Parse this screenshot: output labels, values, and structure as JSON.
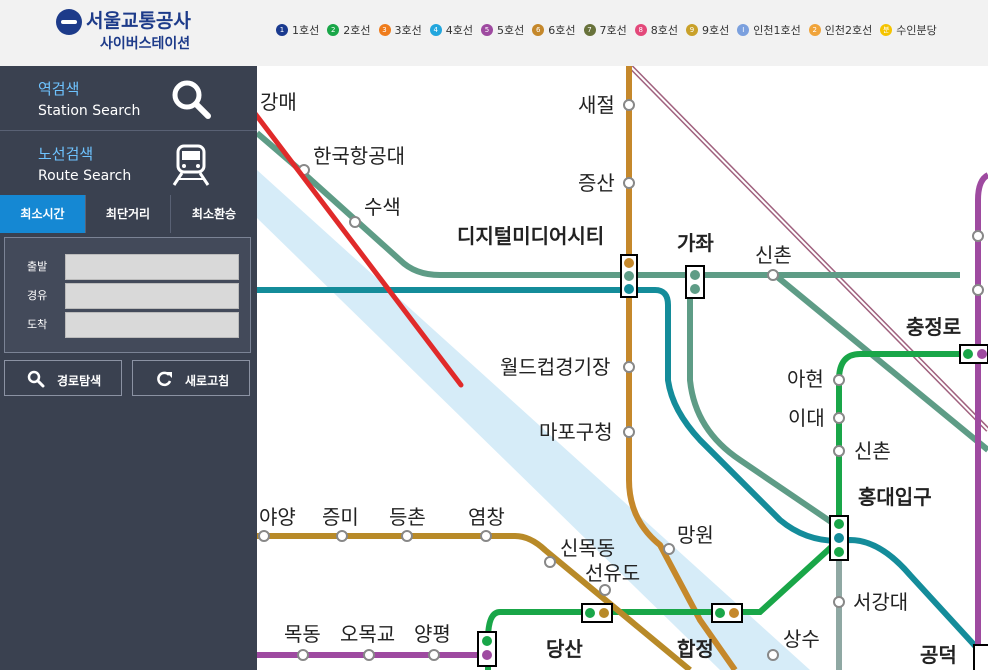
{
  "header": {
    "logo_title": "서울교통공사",
    "logo_subtitle": "사이버스테이션",
    "lines": [
      {
        "num": "1",
        "label": "1호선",
        "color": "#1a3a8f"
      },
      {
        "num": "2",
        "label": "2호선",
        "color": "#19a648"
      },
      {
        "num": "3",
        "label": "3호선",
        "color": "#ef7c1c"
      },
      {
        "num": "4",
        "label": "4호선",
        "color": "#22a6dd"
      },
      {
        "num": "5",
        "label": "5호선",
        "color": "#9e4aa0"
      },
      {
        "num": "6",
        "label": "6호선",
        "color": "#c5882b"
      },
      {
        "num": "7",
        "label": "7호선",
        "color": "#68723b"
      },
      {
        "num": "8",
        "label": "8호선",
        "color": "#e3487a"
      },
      {
        "num": "9",
        "label": "9호선",
        "color": "#c9a12a"
      },
      {
        "num": "I",
        "label": "인천1호선",
        "color": "#7ba0de"
      },
      {
        "num": "2",
        "label": "인천2호선",
        "color": "#f0a43b"
      },
      {
        "num": "분",
        "label": "수인분당",
        "color": "#f5c400"
      }
    ]
  },
  "sidebar": {
    "station_search": {
      "ko": "역검색",
      "en": "Station Search"
    },
    "route_search": {
      "ko": "노선검색",
      "en": "Route Search"
    },
    "tabs": [
      "최소시간",
      "최단거리",
      "최소환승"
    ],
    "fields": {
      "departure": "출발",
      "via": "경유",
      "arrival": "도착"
    },
    "search_button": "경로탐색",
    "refresh_button": "새로고침"
  },
  "colors": {
    "airport": "#5e9c86",
    "line9": "#b88a28",
    "line6": "#c5882b",
    "line2": "#19a648",
    "gyeongui": "#5e9c86",
    "line5": "#9e4aa0",
    "river": "#d6ecf8",
    "line6b": "#148c9a"
  },
  "map": {
    "stations": {
      "gangmae": "강매",
      "hanguk": "한국항공대",
      "susaek": "수색",
      "dmc": "디지털미디어시티",
      "gajwa": "가좌",
      "sinchon_gy": "신촌",
      "saejeol": "새절",
      "jeungsan": "증산",
      "worldcup": "월드컵경기장",
      "mapo_gu": "마포구청",
      "chungjeongno": "충정로",
      "ahyeon": "아현",
      "idae": "이대",
      "sinchon_2": "신촌",
      "hongik": "홍대입구",
      "mangwon": "망원",
      "seogang": "서강대",
      "sinmokdong": "신목동",
      "seonyudo": "선유도",
      "yang": "야양",
      "jeungmi": "증미",
      "deungchon": "등촌",
      "yeomchang": "염창",
      "mokdong": "목동",
      "omokgyo": "오목교",
      "yangpyeong": "양평",
      "dangsan": "당산",
      "hapjeong": "합정",
      "sangsu": "상수",
      "gongdeok": "공덕"
    }
  }
}
